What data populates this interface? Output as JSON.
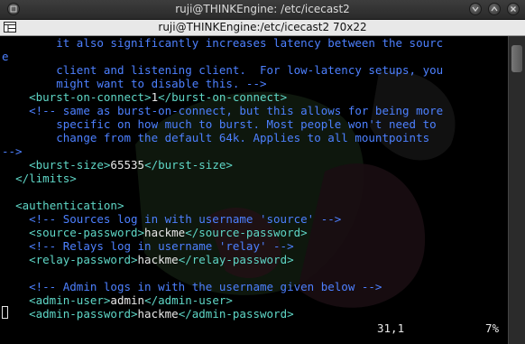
{
  "window": {
    "title": "ruji@THINKEngine: /etc/icecast2"
  },
  "tab": {
    "title": "ruji@THINKEngine:/etc/icecast2 70x22"
  },
  "editor": {
    "lines": [
      {
        "row": 0,
        "indent": "        ",
        "segments": [
          {
            "cls": "c-comment",
            "text": "it also significantly increases latency between the sourc"
          }
        ]
      },
      {
        "row": 1,
        "indent": "",
        "segments": [
          {
            "cls": "c-comment",
            "text": "e"
          }
        ]
      },
      {
        "row": 2,
        "indent": "        ",
        "segments": [
          {
            "cls": "c-comment",
            "text": "client and listening client.  For low-latency setups, you"
          }
        ]
      },
      {
        "row": 3,
        "indent": "        ",
        "segments": [
          {
            "cls": "c-comment",
            "text": "might want to disable this. -->"
          }
        ]
      },
      {
        "row": 4,
        "indent": "    ",
        "segments": [
          {
            "cls": "c-tag",
            "text": "<burst-on-connect>"
          },
          {
            "cls": "c-text",
            "text": "1"
          },
          {
            "cls": "c-tag",
            "text": "</burst-on-connect>"
          }
        ]
      },
      {
        "row": 5,
        "indent": "    ",
        "segments": [
          {
            "cls": "c-comment",
            "text": "<!-- same as burst-on-connect, but this allows for being more"
          }
        ]
      },
      {
        "row": 6,
        "indent": "        ",
        "segments": [
          {
            "cls": "c-comment",
            "text": "specific on how much to burst. Most people won't need to"
          }
        ]
      },
      {
        "row": 7,
        "indent": "        ",
        "segments": [
          {
            "cls": "c-comment",
            "text": "change from the default 64k. Applies to all mountpoints"
          }
        ]
      },
      {
        "row": 8,
        "indent": "",
        "segments": [
          {
            "cls": "c-comment",
            "text": "-->"
          }
        ]
      },
      {
        "row": 9,
        "indent": "    ",
        "segments": [
          {
            "cls": "c-tag",
            "text": "<burst-size>"
          },
          {
            "cls": "c-text",
            "text": "65535"
          },
          {
            "cls": "c-tag",
            "text": "</burst-size>"
          }
        ]
      },
      {
        "row": 10,
        "indent": "  ",
        "segments": [
          {
            "cls": "c-tag",
            "text": "</limits>"
          }
        ]
      },
      {
        "row": 11,
        "indent": "",
        "segments": []
      },
      {
        "row": 12,
        "indent": "  ",
        "segments": [
          {
            "cls": "c-tag",
            "text": "<authentication>"
          }
        ]
      },
      {
        "row": 13,
        "indent": "    ",
        "segments": [
          {
            "cls": "c-comment",
            "text": "<!-- Sources log in with username 'source' -->"
          }
        ]
      },
      {
        "row": 14,
        "indent": "    ",
        "segments": [
          {
            "cls": "c-tag",
            "text": "<source-password>"
          },
          {
            "cls": "c-text",
            "text": "hackme"
          },
          {
            "cls": "c-tag",
            "text": "</source-password>"
          }
        ]
      },
      {
        "row": 15,
        "indent": "    ",
        "segments": [
          {
            "cls": "c-comment",
            "text": "<!-- Relays log in username 'relay' -->"
          }
        ]
      },
      {
        "row": 16,
        "indent": "    ",
        "segments": [
          {
            "cls": "c-tag",
            "text": "<relay-password>"
          },
          {
            "cls": "c-text",
            "text": "hackme"
          },
          {
            "cls": "c-tag",
            "text": "</relay-password>"
          }
        ]
      },
      {
        "row": 17,
        "indent": "",
        "segments": []
      },
      {
        "row": 18,
        "indent": "    ",
        "segments": [
          {
            "cls": "c-comment",
            "text": "<!-- Admin logs in with the username given below -->"
          }
        ]
      },
      {
        "row": 19,
        "indent": "    ",
        "segments": [
          {
            "cls": "c-tag",
            "text": "<admin-user>"
          },
          {
            "cls": "c-text",
            "text": "admin"
          },
          {
            "cls": "c-tag",
            "text": "</admin-user>"
          }
        ]
      },
      {
        "row": 20,
        "indent": "    ",
        "segments": [
          {
            "cls": "c-tag",
            "text": "<admin-password>"
          },
          {
            "cls": "c-text",
            "text": "hackme"
          },
          {
            "cls": "c-tag",
            "text": "</admin-password>"
          }
        ]
      }
    ],
    "status": {
      "position": "31,1",
      "percent": "7%"
    }
  },
  "colors": {
    "comment": "#4d80ff",
    "tag": "#5fd7c7",
    "text": "#e8e8e8",
    "background": "#000000",
    "titlebar": "#333333"
  },
  "icons": {
    "window_menu": "window-menu-icon",
    "minimize": "minimize-icon",
    "maximize": "maximize-icon",
    "close": "close-icon",
    "terminal_tab": "terminal-tab-icon"
  }
}
